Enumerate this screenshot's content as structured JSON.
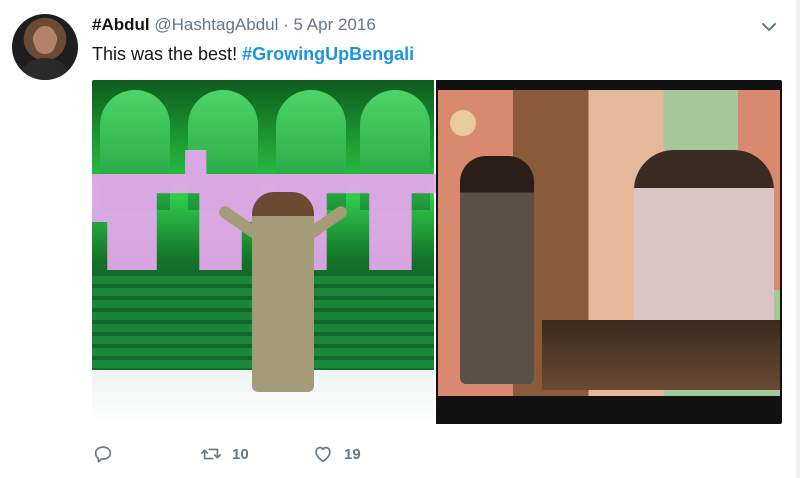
{
  "tweet": {
    "display_name": "#Abdul",
    "handle": "@HashtagAbdul",
    "separator": "·",
    "date": "5 Apr 2016",
    "text_plain": "This was the best! ",
    "hashtag": "#GrowingUpBengali",
    "retweets": "10",
    "likes": "19"
  },
  "icons": {
    "menu": "chevron-down-icon",
    "reply": "reply-icon",
    "retweet": "retweet-icon",
    "like": "heart-icon"
  },
  "colors": {
    "link": "#1b95e0",
    "secondary_text": "#657786",
    "primary_text": "#14171a"
  }
}
